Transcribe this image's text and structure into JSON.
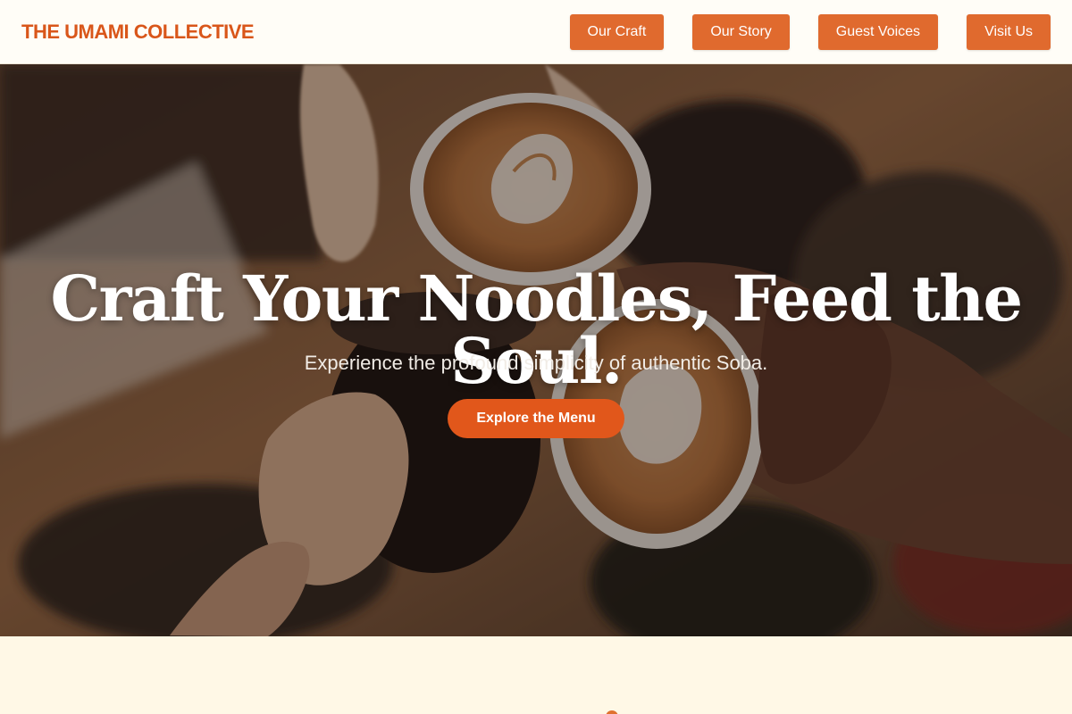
{
  "brand": {
    "name": "THE UMAMI COLLECTIVE"
  },
  "nav": {
    "items": [
      {
        "label": "Our Craft"
      },
      {
        "label": "Our Story"
      },
      {
        "label": "Guest Voices"
      },
      {
        "label": "Visit Us"
      }
    ]
  },
  "hero": {
    "title": "Craft Your Noodles, Feed the Soul.",
    "subtitle": "Experience the profound simplicity of authentic Soba.",
    "cta_label": "Explore the Menu"
  },
  "colors": {
    "brand_orange": "#d9561a",
    "nav_button": "#e06a2e",
    "cta": "#e1571b",
    "section_bg": "#fff8e6"
  }
}
